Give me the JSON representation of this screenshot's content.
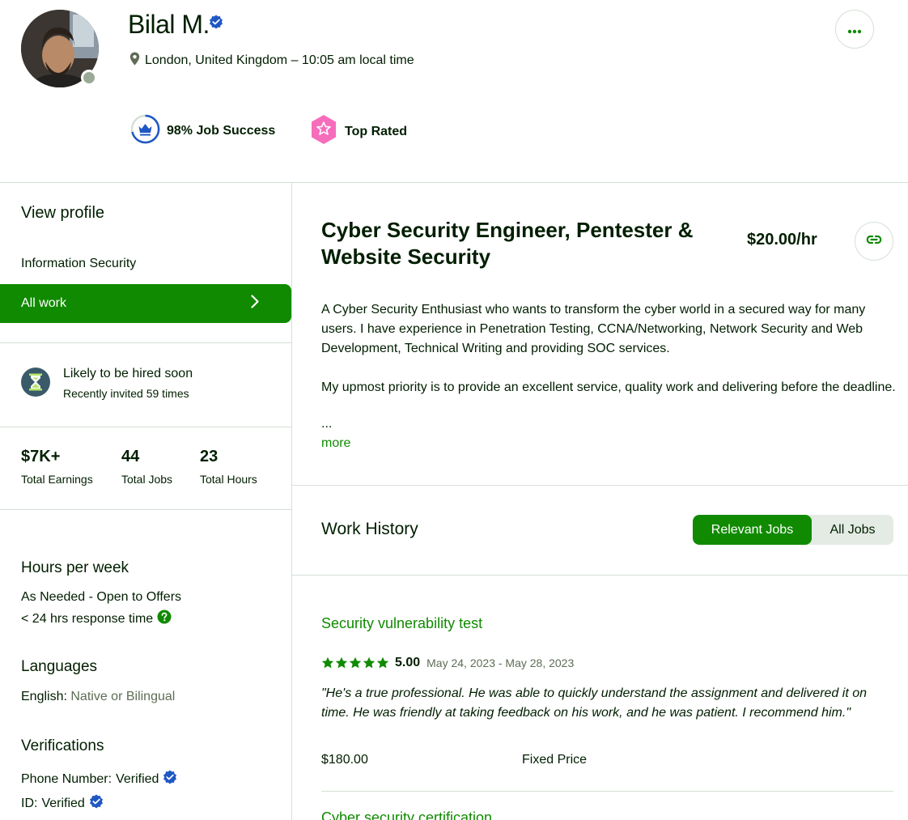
{
  "profile": {
    "name": "Bilal M.",
    "location": "London, United Kingdom – 10:05 am local time",
    "job_success": "98% Job Success",
    "top_rated": "Top Rated"
  },
  "sidebar": {
    "view_profile": "View profile",
    "specialty": "Information Security",
    "all_work": "All work",
    "hired_title": "Likely to be hired soon",
    "hired_sub": "Recently invited 59 times",
    "stats": [
      {
        "value": "$7K+",
        "label": "Total Earnings"
      },
      {
        "value": "44",
        "label": "Total Jobs"
      },
      {
        "value": "23",
        "label": "Total Hours"
      }
    ],
    "hours_heading": "Hours per week",
    "hours_value": "As Needed - Open to Offers",
    "response_time": "< 24 hrs response time",
    "languages_heading": "Languages",
    "language_name": "English:",
    "language_level": "Native or Bilingual",
    "verifications_heading": "Verifications",
    "phone_label": "Phone Number:",
    "phone_value": "Verified",
    "id_label": "ID:",
    "id_value": "Verified"
  },
  "main": {
    "title": "Cyber Security Engineer, Pentester & Website Security",
    "rate": "$20.00/hr",
    "description_p1": "A Cyber Security Enthusiast who wants to transform the cyber world in a secured way for many users. I have experience in Penetration Testing, CCNA/Networking, Network Security and Web Development, Technical Writing and providing SOC services.",
    "description_p2": "My upmost priority is to provide an excellent service, quality work and delivering before the deadline.",
    "ellipsis": "...",
    "more": "more",
    "work_history": "Work History",
    "tabs": [
      "Relevant Jobs",
      "All Jobs"
    ],
    "jobs": [
      {
        "title": "Security vulnerability test",
        "rating": "5.00",
        "stars": 5,
        "dates": "May 24, 2023 - May 28, 2023",
        "review": "\"He's a true professional. He was able to quickly understand the assignment and delivered it on time. He was friendly at taking feedback on his work, and he was patient. I recommend him.\"",
        "price": "$180.00",
        "price_type": "Fixed Price"
      },
      {
        "title": "Cyber security certification"
      }
    ]
  },
  "icons": {
    "verified": "verified-badge-icon",
    "location": "map-pin-icon",
    "more": "more-horizontal-icon",
    "link": "link-icon",
    "chevron": "chevron-right-icon",
    "hourglass": "hourglass-icon",
    "help": "question-icon",
    "crown": "crown-icon",
    "star": "star-icon"
  },
  "colors": {
    "brand_green": "#108a00",
    "verified_blue": "#1f57c3",
    "top_rated_pink": "#f66dbc",
    "text_dark": "#001e00",
    "text_muted": "#5e6d55",
    "divider": "#d5e0d5"
  }
}
